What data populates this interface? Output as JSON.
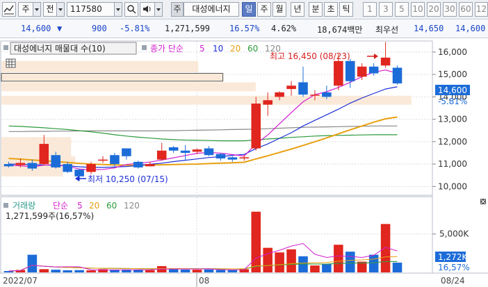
{
  "toolbar": {
    "period_select": "주",
    "compare_select": "전",
    "stock_code": "117580",
    "stock_name": "대성에너지",
    "stock_tag": "주",
    "timeframes": [
      "일",
      "주",
      "월",
      "년",
      "분",
      "초",
      "틱"
    ],
    "active_timeframe": "일",
    "intervals": [
      "1",
      "3",
      "5",
      "10",
      "20",
      "30",
      "60",
      "12"
    ]
  },
  "quote": {
    "price": "14,600",
    "direction": "▼",
    "change": "900",
    "change_pct": "-5.81%",
    "volume": "1,271,599",
    "vol_ratio": "16.57%",
    "turnover_pct": "4.62%",
    "amount": "18,674백만",
    "bid_label": "최우선",
    "bid": "14,650",
    "ask": "14,600"
  },
  "price_panel": {
    "title": "대성에너지 매물대 수(10)",
    "ma_legend_label": "종가 단순",
    "ma_periods": [
      "5",
      "10",
      "20",
      "60",
      "120"
    ],
    "ma_colors": [
      "#d21ecf",
      "#1c2fd6",
      "#e8a010",
      "#2a9a3a",
      "#888888"
    ],
    "high_annotation": "최고 16,450 (08/23)",
    "low_annotation": "최저 10,250 (07/15)",
    "current_price_tag": "14,600",
    "current_change_tag": "-5.81%",
    "y_ticks": [
      "16,000",
      "15,000",
      "14,000",
      "13,000",
      "12,000",
      "11,000",
      "10,000"
    ]
  },
  "volume_panel": {
    "title": "거래량",
    "ma_label": "단순",
    "ma_periods": [
      "5",
      "20",
      "60",
      "120"
    ],
    "summary": "1,271,599주(16,57%)",
    "y_tick": "5,000K",
    "current_tag": "1,272K",
    "current_pct": "16,57%"
  },
  "x_axis": {
    "labels": [
      "2022/07",
      "08",
      "08/24"
    ]
  },
  "colors": {
    "up": "#e0261e",
    "down": "#1c6cd8",
    "accent": "#5b7cc4"
  },
  "chart_data": {
    "type": "candlestick",
    "y_unit": "KRW",
    "ylim": [
      9700,
      16400
    ],
    "candles": [
      {
        "o": 11000,
        "h": 11100,
        "l": 10850,
        "c": 10900
      },
      {
        "o": 10950,
        "h": 11250,
        "l": 10850,
        "c": 11050
      },
      {
        "o": 11050,
        "h": 11200,
        "l": 10700,
        "c": 10800
      },
      {
        "o": 11000,
        "h": 12300,
        "l": 10950,
        "c": 11900
      },
      {
        "o": 11400,
        "h": 11550,
        "l": 10800,
        "c": 10850
      },
      {
        "o": 11000,
        "h": 11100,
        "l": 10600,
        "c": 10650
      },
      {
        "o": 10750,
        "h": 10800,
        "l": 10250,
        "c": 10450
      },
      {
        "o": 10650,
        "h": 11100,
        "l": 10550,
        "c": 11000
      },
      {
        "o": 11150,
        "h": 11350,
        "l": 11050,
        "c": 11200
      },
      {
        "o": 11400,
        "h": 11500,
        "l": 10900,
        "c": 11000
      },
      {
        "o": 11700,
        "h": 11700,
        "l": 11200,
        "c": 11350
      },
      {
        "o": 11100,
        "h": 11150,
        "l": 10800,
        "c": 10850
      },
      {
        "o": 10900,
        "h": 11100,
        "l": 10900,
        "c": 11000
      },
      {
        "o": 11200,
        "h": 11950,
        "l": 11150,
        "c": 11600
      },
      {
        "o": 11750,
        "h": 11800,
        "l": 11500,
        "c": 11600
      },
      {
        "o": 11600,
        "h": 11850,
        "l": 11150,
        "c": 11500
      },
      {
        "o": 11550,
        "h": 11700,
        "l": 11450,
        "c": 11650
      },
      {
        "o": 11700,
        "h": 11800,
        "l": 11350,
        "c": 11400
      },
      {
        "o": 11450,
        "h": 11500,
        "l": 11150,
        "c": 11250
      },
      {
        "o": 11300,
        "h": 11350,
        "l": 11100,
        "c": 11200
      },
      {
        "o": 11250,
        "h": 11400,
        "l": 11150,
        "c": 11300
      },
      {
        "o": 11700,
        "h": 14000,
        "l": 11600,
        "c": 13700
      },
      {
        "o": 13650,
        "h": 14200,
        "l": 13150,
        "c": 13850
      },
      {
        "o": 14000,
        "h": 14250,
        "l": 13850,
        "c": 14200
      },
      {
        "o": 14350,
        "h": 14700,
        "l": 14050,
        "c": 14500
      },
      {
        "o": 14650,
        "h": 15350,
        "l": 14000,
        "c": 14100
      },
      {
        "o": 14100,
        "h": 14300,
        "l": 13850,
        "c": 14100
      },
      {
        "o": 14200,
        "h": 14500,
        "l": 13900,
        "c": 14000
      },
      {
        "o": 14500,
        "h": 15900,
        "l": 14300,
        "c": 15600
      },
      {
        "o": 15600,
        "h": 15700,
        "l": 14400,
        "c": 14700
      },
      {
        "o": 14900,
        "h": 15500,
        "l": 14750,
        "c": 15350
      },
      {
        "o": 15350,
        "h": 15500,
        "l": 14950,
        "c": 15050
      },
      {
        "o": 15400,
        "h": 16450,
        "l": 15300,
        "c": 15750
      },
      {
        "o": 15300,
        "h": 15400,
        "l": 14550,
        "c": 14600
      }
    ],
    "ma5": [
      10950,
      10920,
      10880,
      10950,
      10980,
      10900,
      10780,
      10740,
      10760,
      10830,
      10980,
      11040,
      11090,
      11180,
      11280,
      11380,
      11480,
      11520,
      11490,
      11420,
      11360,
      11900,
      12300,
      12800,
      13300,
      13780,
      14100,
      14230,
      14420,
      14650,
      14900,
      15100,
      15200,
      15050
    ],
    "ma10": [
      11000,
      10990,
      10970,
      10960,
      10940,
      10920,
      10880,
      10850,
      10850,
      10870,
      10890,
      10940,
      10990,
      11040,
      11110,
      11170,
      11230,
      11290,
      11330,
      11390,
      11430,
      11690,
      11900,
      12150,
      12400,
      12700,
      12950,
      13200,
      13450,
      13720,
      13950,
      14150,
      14350,
      14450
    ],
    "ma20": [
      11250,
      11220,
      11180,
      11150,
      11110,
      11070,
      11030,
      11000,
      10980,
      10960,
      10950,
      10950,
      10960,
      10970,
      10980,
      10990,
      11000,
      11020,
      11040,
      11060,
      11080,
      11230,
      11370,
      11520,
      11670,
      11830,
      12000,
      12170,
      12350,
      12530,
      12700,
      12870,
      13020,
      13100
    ],
    "ma60": [
      12700,
      12680,
      12650,
      12620,
      12580,
      12540,
      12490,
      12440,
      12380,
      12310,
      12250,
      12200,
      12160,
      12120,
      12090,
      12070,
      12060,
      12050,
      12040,
      12040,
      12040,
      12080,
      12120,
      12150,
      12190,
      12220,
      12250,
      12270,
      12280,
      12290,
      12300,
      12310,
      12310,
      12310
    ],
    "ma120": [
      12450,
      12450,
      12460,
      12460,
      12470,
      12470,
      12480,
      12480,
      12480,
      12480,
      12480,
      12480,
      12480,
      12490,
      12490,
      12500,
      12510,
      12520,
      12530,
      12540,
      12550,
      12560,
      12580,
      12600,
      12620,
      12640,
      12650,
      12660,
      12670,
      12680,
      12690,
      12700,
      12700,
      12700
    ],
    "volume_profile": [
      {
        "low": 15100,
        "high": 15600,
        "size": 0.48
      },
      {
        "low": 14700,
        "high": 15050,
        "size": 0.54
      },
      {
        "low": 14250,
        "high": 14650,
        "size": 0.62
      },
      {
        "low": 13650,
        "high": 14050,
        "size": 1.0
      },
      {
        "low": 11750,
        "high": 12200,
        "size": 0.17
      },
      {
        "low": 11350,
        "high": 11750,
        "size": 0.17
      },
      {
        "low": 10950,
        "high": 11350,
        "size": 0.18
      },
      {
        "low": 10450,
        "high": 10950,
        "size": 0.15
      }
    ],
    "volume": [
      180,
      320,
      2300,
      420,
      350,
      280,
      300,
      260,
      420,
      350,
      380,
      320,
      300,
      820,
      400,
      360,
      350,
      380,
      330,
      300,
      420,
      7900,
      3200,
      2600,
      3000,
      2100,
      900,
      1100,
      3600,
      2700,
      1400,
      2300,
      6300,
      1272
    ],
    "volume_ylim": [
      0,
      8500
    ]
  }
}
